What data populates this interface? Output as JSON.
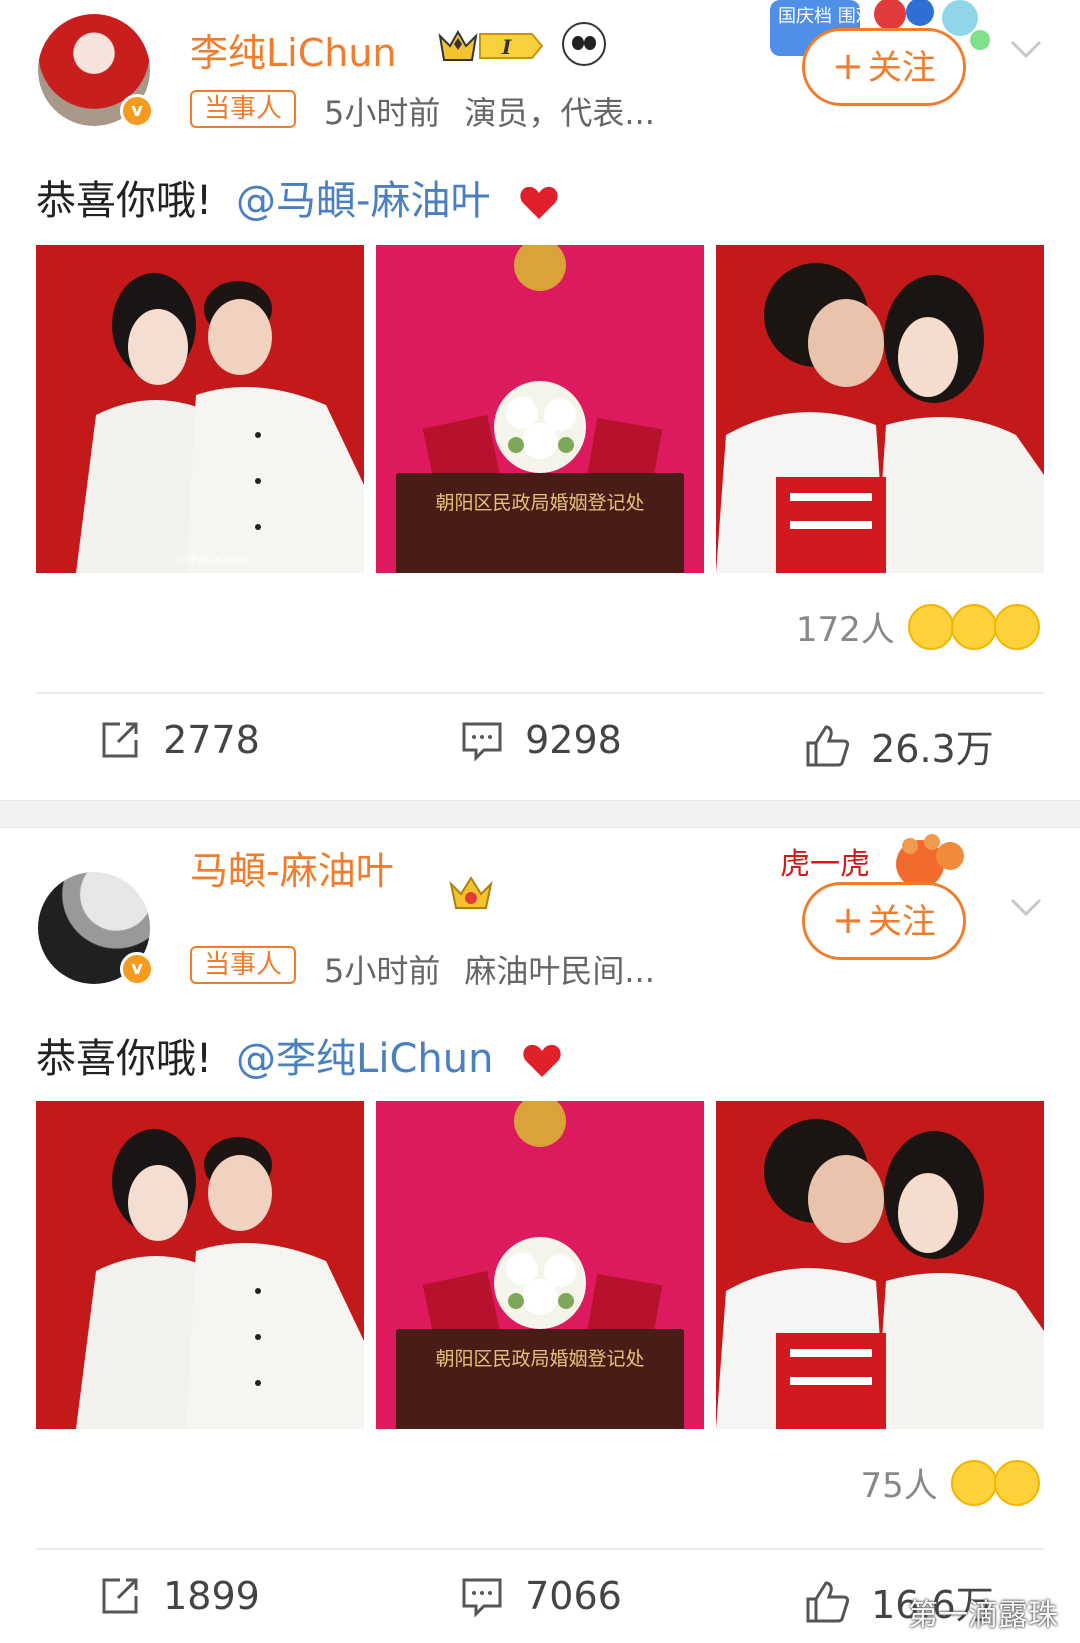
{
  "posts": [
    {
      "username": "李纯LiChun",
      "tag": "当事人",
      "time": "5小时前",
      "desc": "演员，代表...",
      "follow": "关注",
      "text": "恭喜你哦!",
      "mention": "@马頔-麻油叶",
      "photo_watermark": "@李纯LiChun",
      "office_sign": "朝阳区民政局婚姻登记处",
      "reaction_count": "172人",
      "share_count": "2778",
      "comment_count": "9298",
      "like_count": "26.3万",
      "vip_level": "I"
    },
    {
      "username": "马頔-麻油叶",
      "tag": "当事人",
      "time": "5小时前",
      "desc": "麻油叶民间...",
      "follow": "关注",
      "text": "恭喜你哦!",
      "mention": "@李纯LiChun",
      "office_sign": "朝阳区民政局婚姻登记处",
      "reaction_count": "75人",
      "share_count": "1899",
      "comment_count": "7066",
      "like_count": "16.6万"
    }
  ],
  "deco": {
    "post1_banner": "国庆档 围观",
    "post2_banner": "虎一虎"
  },
  "watermark": "第一滴露珠",
  "colors": {
    "accent_orange": "#f07c2c",
    "mention_blue": "#4a7fc1",
    "heart_red": "#e0202a",
    "photo_red": "#c71b1b",
    "photo_pink": "#e0195f"
  },
  "icons": [
    "share-icon",
    "comment-icon",
    "like-icon",
    "chevron-down-icon",
    "heart-icon",
    "verified-icon",
    "crown-icon",
    "panda-icon"
  ]
}
